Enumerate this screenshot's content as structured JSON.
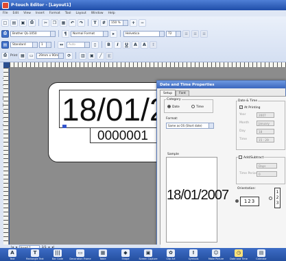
{
  "window": {
    "title": "P-touch Editor - [Layout1]"
  },
  "menu": [
    "File",
    "Edit",
    "View",
    "Insert",
    "Format",
    "Tool",
    "Layout",
    "Window",
    "Help"
  ],
  "toolbar": {
    "printer": "Brother QL-1050",
    "tape_mode": "Standard",
    "zoom": "150 %",
    "print_label": "Print",
    "style": "Normal Format",
    "font": "Helvetica",
    "font_size": "72",
    "media": "29mm x 90mm",
    "length_unit": "Auto"
  },
  "canvas": {
    "date_text": "18/01/20",
    "number_text": "0000001"
  },
  "dialog": {
    "title": "Date and Time Properties",
    "tabs": [
      "Setup",
      "Font"
    ],
    "category_label": "Category",
    "category_options": [
      "Date",
      "Time"
    ],
    "format_label": "Format:",
    "format_value": "Same as OS (Short date)",
    "sample_label": "Sample",
    "sample_text": "18/01/2007",
    "datetime_label": "Date & Time",
    "at_printing_label": "At Printing",
    "fields": [
      {
        "label": "Year",
        "value": "2007"
      },
      {
        "label": "Month",
        "value": "January"
      },
      {
        "label": "Day",
        "value": "18"
      },
      {
        "label": "Time",
        "value": "15 : 29"
      }
    ],
    "add_subtract_label": "Add/Subtract",
    "add_fields": [
      {
        "label": "",
        "value": "Days"
      },
      {
        "label": "Time Period",
        "value": "0"
      }
    ],
    "orientation_label": "Orientation:",
    "orient_h": "123",
    "orient_v": [
      "1",
      "2",
      "3"
    ],
    "ok_label": "OK"
  },
  "status": {
    "object_name": "Insert 1",
    "page": "1/1"
  },
  "palette": [
    {
      "label": "Text",
      "icon": "text-icon",
      "glyph": "A"
    },
    {
      "label": "Rectangle Text",
      "icon": "rect-text-icon",
      "glyph": "T"
    },
    {
      "label": "Bar Code",
      "icon": "barcode-icon",
      "glyph": "|||"
    },
    {
      "label": "Decoration Frame",
      "icon": "frame-icon",
      "glyph": "▭"
    },
    {
      "label": "Table",
      "icon": "table-icon",
      "glyph": "▦"
    },
    {
      "label": "Shape",
      "icon": "shape-icon",
      "glyph": "◆"
    },
    {
      "label": "Screen Capture",
      "icon": "capture-icon",
      "glyph": "▣"
    },
    {
      "label": "Clip Art",
      "icon": "clipart-icon",
      "glyph": "✿"
    },
    {
      "label": "Symbols",
      "icon": "symbol-icon",
      "glyph": "!"
    },
    {
      "label": "Make Picture",
      "icon": "picture-icon",
      "glyph": "☺"
    },
    {
      "label": "Date and Time",
      "icon": "clock-icon",
      "glyph": "◷",
      "selected": true
    },
    {
      "label": "Calendar",
      "icon": "calendar-icon",
      "glyph": "▤"
    }
  ],
  "tabs_bottom": [
    "Insert New",
    "Favorites",
    "History"
  ]
}
